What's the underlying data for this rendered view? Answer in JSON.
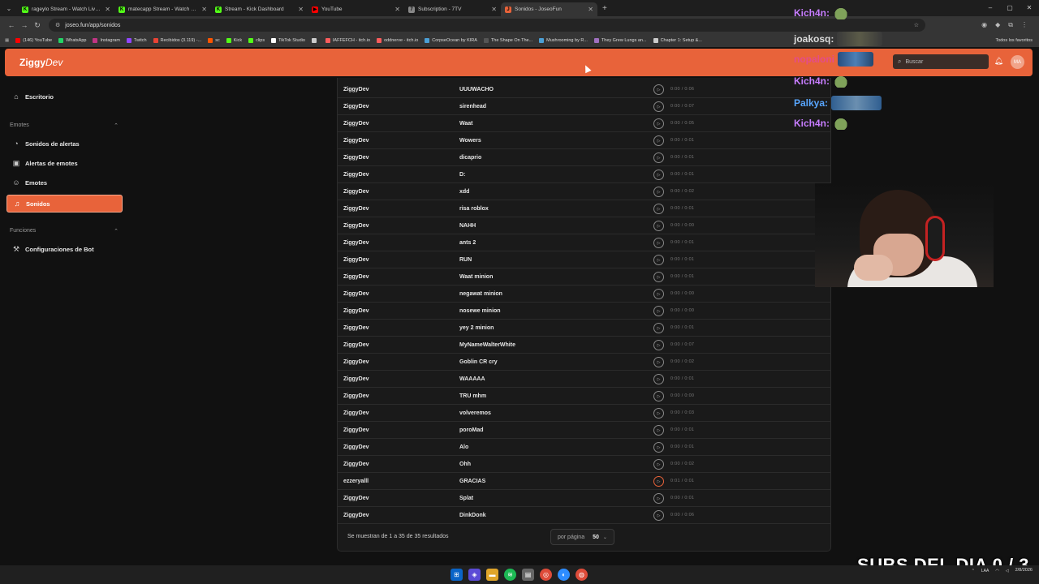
{
  "browser": {
    "tabs": [
      {
        "title": "rageylo Stream - Watch Live o",
        "fav_color": "#53fc18",
        "fav_glyph": "K",
        "active": false
      },
      {
        "title": "matecapp Stream - Watch Live",
        "fav_color": "#53fc18",
        "fav_glyph": "K",
        "active": false
      },
      {
        "title": "Stream - Kick Dashboard",
        "fav_color": "#53fc18",
        "fav_glyph": "K",
        "active": false
      },
      {
        "title": "YouTube",
        "fav_color": "#ff0000",
        "fav_glyph": "▶",
        "active": false
      },
      {
        "title": "Subscription - 7TV",
        "fav_color": "#888888",
        "fav_glyph": "7",
        "active": false
      },
      {
        "title": "Sonidos - JoseoFun",
        "fav_color": "#e8633a",
        "fav_glyph": "J",
        "active": true
      }
    ],
    "url": "joseo.fun/app/sonidos",
    "bookmarks": [
      {
        "label": "(146) YouTube",
        "color": "#ff0000"
      },
      {
        "label": "WhatsApp",
        "color": "#25d366"
      },
      {
        "label": "Instagram",
        "color": "#c13584"
      },
      {
        "label": "Twitch",
        "color": "#9146ff"
      },
      {
        "label": "Recibidos (3.119) -...",
        "color": "#ea4335"
      },
      {
        "label": "sc",
        "color": "#ff5500"
      },
      {
        "label": "Kick",
        "color": "#53fc18"
      },
      {
        "label": "clips",
        "color": "#53fc18"
      },
      {
        "label": "TikTok Studio",
        "color": "#ffffff"
      },
      {
        "label": "",
        "color": "#cccccc"
      },
      {
        "label": "IAFFEFCH - itch.io",
        "color": "#fa5c5c"
      },
      {
        "label": "oddnerve - itch.io",
        "color": "#fa5c5c"
      },
      {
        "label": "CorpseOcean by KIRA",
        "color": "#4b9fd5"
      },
      {
        "label": "The Shape On The...",
        "color": "#555555"
      },
      {
        "label": "Mushrooming by R...",
        "color": "#4b9fd5"
      },
      {
        "label": "They Grew Lungs an...",
        "color": "#a070c0"
      },
      {
        "label": "Chapter 1: Setup &...",
        "color": "#cccccc"
      }
    ],
    "all_bookmarks": "Todos los favoritos"
  },
  "header": {
    "logo_main": "Ziggy",
    "logo_accent": "Dev",
    "search_placeholder": "Buscar",
    "avatar_initials": "MA"
  },
  "sidebar": {
    "escritorio": "Escritorio",
    "section_emotes": "Emotes",
    "sonidos_alertas": "Sonidos de alertas",
    "alertas_emotes": "Alertas de emotes",
    "emotes": "Emotes",
    "sonidos": "Sonidos",
    "section_funciones": "Funciones",
    "config_bot": "Configuraciones de Bot"
  },
  "table": {
    "rows": [
      {
        "user": "ZiggyDev",
        "name": "UUUWACHO",
        "time": "0:00 / 0:06",
        "playing": false
      },
      {
        "user": "ZiggyDev",
        "name": "sirenhead",
        "time": "0:00 / 0:07",
        "playing": false
      },
      {
        "user": "ZiggyDev",
        "name": "Waat",
        "time": "0:00 / 0:05",
        "playing": false
      },
      {
        "user": "ZiggyDev",
        "name": "Wowers",
        "time": "0:00 / 0:01",
        "playing": false
      },
      {
        "user": "ZiggyDev",
        "name": "dicaprio",
        "time": "0:00 / 0:01",
        "playing": false
      },
      {
        "user": "ZiggyDev",
        "name": "D:",
        "time": "0:00 / 0:01",
        "playing": false
      },
      {
        "user": "ZiggyDev",
        "name": "xdd",
        "time": "0:00 / 0:02",
        "playing": false
      },
      {
        "user": "ZiggyDev",
        "name": "risa roblox",
        "time": "0:00 / 0:01",
        "playing": false
      },
      {
        "user": "ZiggyDev",
        "name": "NAHH",
        "time": "0:00 / 0:00",
        "playing": false
      },
      {
        "user": "ZiggyDev",
        "name": "ants 2",
        "time": "0:00 / 0:01",
        "playing": false
      },
      {
        "user": "ZiggyDev",
        "name": "RUN",
        "time": "0:00 / 0:01",
        "playing": false
      },
      {
        "user": "ZiggyDev",
        "name": "Waat minion",
        "time": "0:00 / 0:01",
        "playing": false
      },
      {
        "user": "ZiggyDev",
        "name": "negawat minion",
        "time": "0:00 / 0:00",
        "playing": false
      },
      {
        "user": "ZiggyDev",
        "name": "nosewe minion",
        "time": "0:00 / 0:00",
        "playing": false
      },
      {
        "user": "ZiggyDev",
        "name": "yey 2 minion",
        "time": "0:00 / 0:01",
        "playing": false
      },
      {
        "user": "ZiggyDev",
        "name": "MyNameWalterWhite",
        "time": "0:00 / 0:07",
        "playing": false
      },
      {
        "user": "ZiggyDev",
        "name": "Goblin CR cry",
        "time": "0:00 / 0:02",
        "playing": false
      },
      {
        "user": "ZiggyDev",
        "name": "WAAAAA",
        "time": "0:00 / 0:01",
        "playing": false
      },
      {
        "user": "ZiggyDev",
        "name": "TRU mhm",
        "time": "0:00 / 0:00",
        "playing": false
      },
      {
        "user": "ZiggyDev",
        "name": "volveremos",
        "time": "0:00 / 0:03",
        "playing": false
      },
      {
        "user": "ZiggyDev",
        "name": "poroMad",
        "time": "0:00 / 0:01",
        "playing": false
      },
      {
        "user": "ZiggyDev",
        "name": "Alo",
        "time": "0:00 / 0:01",
        "playing": false
      },
      {
        "user": "ZiggyDev",
        "name": "Ohh",
        "time": "0:00 / 0:02",
        "playing": false
      },
      {
        "user": "ezzeryalll",
        "name": "GRACIAS",
        "time": "0:01 / 0:01",
        "playing": true
      },
      {
        "user": "ZiggyDev",
        "name": "Splat",
        "time": "0:00 / 0:01",
        "playing": false
      },
      {
        "user": "ZiggyDev",
        "name": "DinkDonk",
        "time": "0:00 / 0:06",
        "playing": false
      }
    ],
    "results_text": "Se muestran de 1 a 35 de 35 resultados",
    "per_page_label": "por página",
    "per_page_value": "50"
  },
  "overlay": {
    "chat": [
      {
        "user": "Kich4n:",
        "color": "#c77dff",
        "emote": "frog"
      },
      {
        "user": "joakosq:",
        "color": "#dddddd",
        "emote": "dark"
      },
      {
        "user": "nopaloni",
        "color": "#e34c8a",
        "emote": "blue"
      },
      {
        "user": "Kich4n:",
        "color": "#c77dff",
        "emote": "frog"
      },
      {
        "user": "Palkya:",
        "color": "#58a6ff",
        "emote": "pal"
      },
      {
        "user": "Kich4n:",
        "color": "#c77dff",
        "emote": "frog"
      }
    ],
    "subs_counter": "SUBS DEL DIA 0 / 3"
  },
  "taskbar": {
    "lang": "LAA",
    "date": "2/8/2026"
  },
  "colors": {
    "accent": "#e8633a"
  }
}
